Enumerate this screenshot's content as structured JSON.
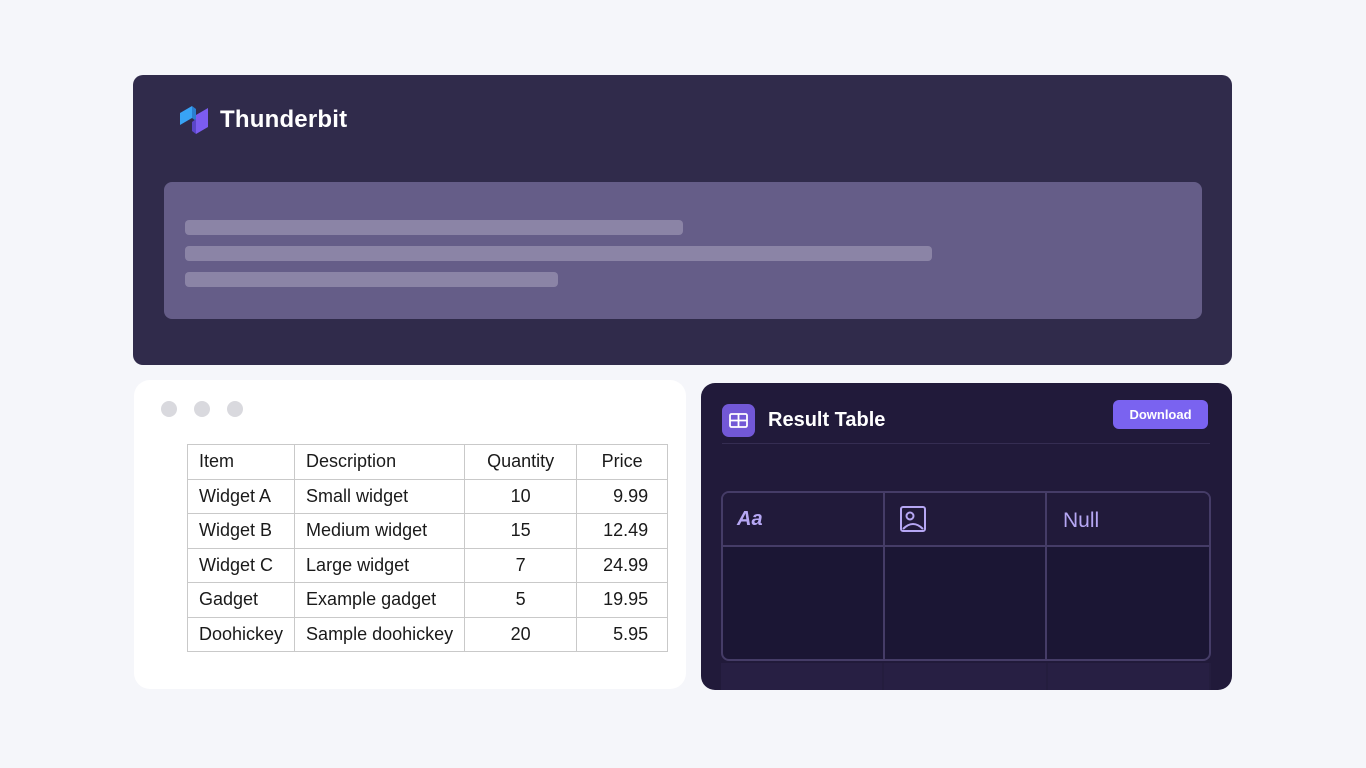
{
  "brand": {
    "name": "Thunderbit",
    "logo_icon": "thunderbit-logo-icon",
    "colors": {
      "panel": "#302b4b",
      "accent": "#7a63f0",
      "logo_blue": "#38a3f5",
      "logo_purple": "#7b5cf0"
    }
  },
  "sheet": {
    "window_dots": [
      "close-dot",
      "minimize-dot",
      "maximize-dot"
    ],
    "headers": [
      "Item",
      "Description",
      "Quantity",
      "Price"
    ],
    "rows": [
      [
        "Widget A",
        "Small widget",
        "10",
        "9.99"
      ],
      [
        "Widget B",
        "Medium widget",
        "15",
        "12.49"
      ],
      [
        "Widget C",
        "Large widget",
        "7",
        "24.99"
      ],
      [
        "Gadget",
        "Example gadget",
        "5",
        "19.95"
      ],
      [
        "Doohickey",
        "Sample doohickey",
        "20",
        "5.95"
      ]
    ]
  },
  "result": {
    "title": "Result Table",
    "title_icon": "table-icon",
    "download_label": "Download",
    "columns": [
      {
        "type": "text",
        "label": "Aa",
        "icon": "text-type-icon"
      },
      {
        "type": "image",
        "label": "",
        "icon": "image-icon"
      },
      {
        "type": "null",
        "label": "Null",
        "icon": ""
      }
    ]
  }
}
